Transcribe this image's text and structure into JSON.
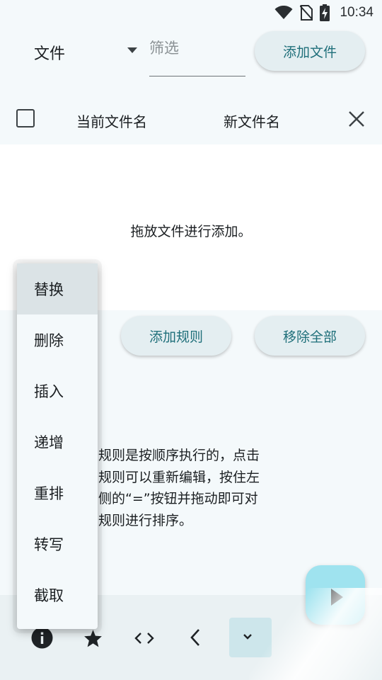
{
  "status_bar": {
    "time": "10:34",
    "icons": [
      "wifi-icon",
      "no-sim-icon",
      "battery-charging-icon"
    ]
  },
  "top_bar": {
    "type_select_value": "文件",
    "filter_placeholder": "筛选",
    "filter_value": "",
    "add_file_label": "添加文件"
  },
  "file_table": {
    "column_current": "当前文件名",
    "column_new": "新文件名",
    "empty_message": "拖放文件进行添加。"
  },
  "rules": {
    "add_rule_label": "添加规则",
    "remove_all_label": "移除全部",
    "help_lines": [
      "规则是按顺序执行的，点击",
      "规则可以重新编辑，按住左",
      "侧的“=”按钮并拖动即可对",
      "规则进行排序。"
    ]
  },
  "rule_menu": {
    "items": [
      {
        "label": "替换",
        "highlighted": true
      },
      {
        "label": "删除"
      },
      {
        "label": "插入"
      },
      {
        "label": "递增"
      },
      {
        "label": "重排"
      },
      {
        "label": "转写"
      },
      {
        "label": "截取"
      }
    ]
  },
  "bottom_bar": {
    "icons": [
      "info-icon",
      "star-icon",
      "code-icon",
      "chevron-left-icon",
      "chevron-down-icon"
    ]
  },
  "fab": {
    "icon": "play-icon"
  },
  "colors": {
    "background": "#f4f9fb",
    "accent_text": "#1f6f7a",
    "pill_bg": "#e4eef1",
    "fab_bg": "#9fe3ef",
    "menu_highlight": "#dbe3e6"
  }
}
